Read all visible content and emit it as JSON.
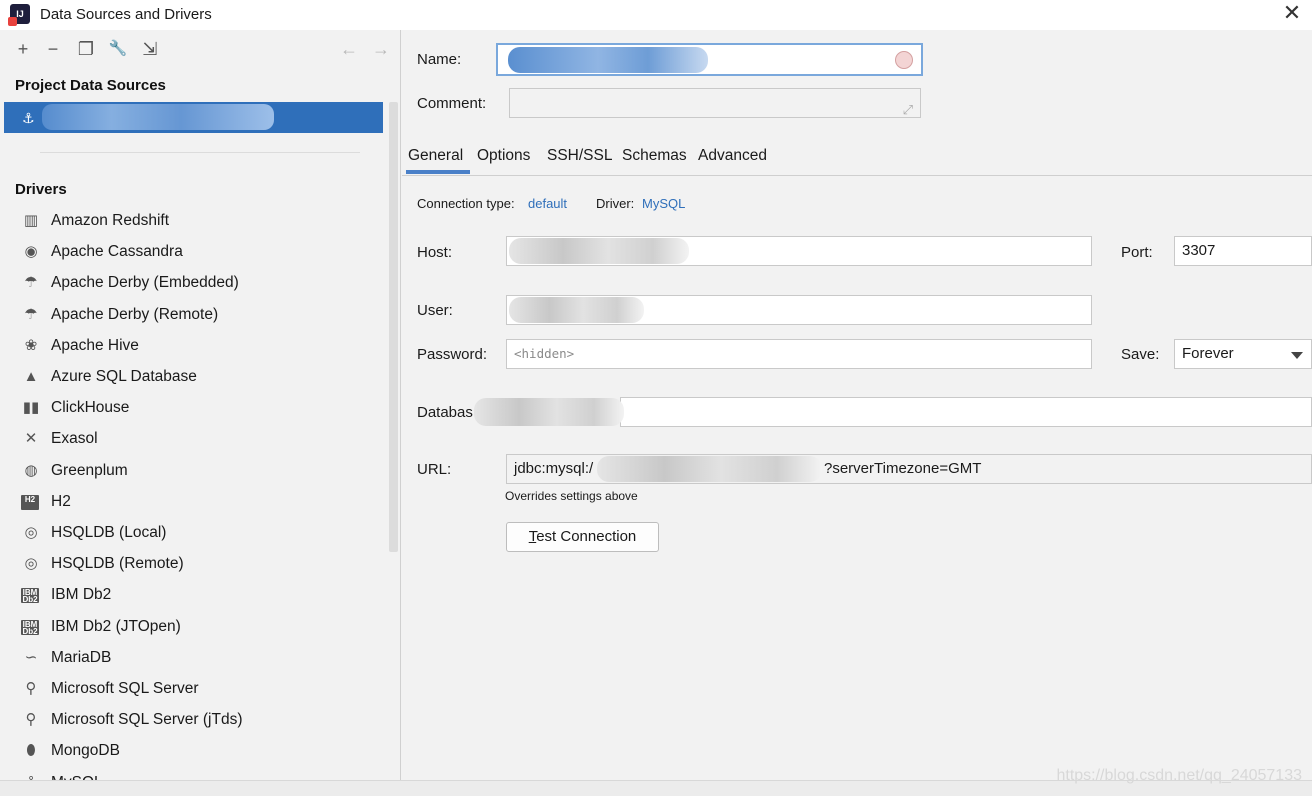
{
  "window": {
    "title": "Data Sources and Drivers",
    "close_glyph": "✕"
  },
  "toolbar": {
    "add": "+",
    "remove": "−",
    "duplicate": "❐",
    "settings": "🔧",
    "import": "⇲",
    "back": "←",
    "forward": "→"
  },
  "sidebar": {
    "project_heading": "Project Data Sources",
    "drivers_heading": "Drivers",
    "drivers": [
      {
        "label": "Amazon Redshift",
        "icon": "amazon-redshift-icon",
        "glyph": "▥"
      },
      {
        "label": "Apache Cassandra",
        "icon": "cassandra-icon",
        "glyph": "◉"
      },
      {
        "label": "Apache Derby (Embedded)",
        "icon": "derby-icon",
        "glyph": "☂"
      },
      {
        "label": "Apache Derby (Remote)",
        "icon": "derby-icon",
        "glyph": "☂"
      },
      {
        "label": "Apache Hive",
        "icon": "hive-icon",
        "glyph": "❀"
      },
      {
        "label": "Azure SQL Database",
        "icon": "azure-icon",
        "glyph": "▲"
      },
      {
        "label": "ClickHouse",
        "icon": "clickhouse-icon",
        "glyph": "▮▮"
      },
      {
        "label": "Exasol",
        "icon": "exasol-icon",
        "glyph": "✕"
      },
      {
        "label": "Greenplum",
        "icon": "greenplum-icon",
        "glyph": "◍"
      },
      {
        "label": "H2",
        "icon": "h2-icon",
        "glyph": "H2"
      },
      {
        "label": "HSQLDB (Local)",
        "icon": "hsqldb-icon",
        "glyph": "◎"
      },
      {
        "label": "HSQLDB (Remote)",
        "icon": "hsqldb-icon",
        "glyph": "◎"
      },
      {
        "label": "IBM Db2",
        "icon": "ibm-db2-icon",
        "glyph": "IBM Db2"
      },
      {
        "label": "IBM Db2 (JTOpen)",
        "icon": "ibm-db2-icon",
        "glyph": "IBM Db2"
      },
      {
        "label": "MariaDB",
        "icon": "mariadb-icon",
        "glyph": "∽"
      },
      {
        "label": "Microsoft SQL Server",
        "icon": "mssql-icon",
        "glyph": "⚲"
      },
      {
        "label": "Microsoft SQL Server (jTds)",
        "icon": "mssql-icon",
        "glyph": "⚲"
      },
      {
        "label": "MongoDB",
        "icon": "mongodb-icon",
        "glyph": "⬮"
      },
      {
        "label": "MySQL",
        "icon": "mysql-icon",
        "glyph": "⚓"
      }
    ]
  },
  "form": {
    "name_label": "Name:",
    "comment_label": "Comment:",
    "tabs": [
      "General",
      "Options",
      "SSH/SSL",
      "Schemas",
      "Advanced"
    ],
    "connection_type_label": "Connection type:",
    "connection_type_value": "default",
    "driver_label": "Driver:",
    "driver_value": "MySQL",
    "host_label": "Host:",
    "port_label": "Port:",
    "port_value": "3307",
    "user_label": "User:",
    "password_label": "Password:",
    "password_placeholder": "<hidden>",
    "save_label": "Save:",
    "save_value": "Forever",
    "database_label": "Databas",
    "url_label": "URL:",
    "url_prefix": "jdbc:mysql:/",
    "url_suffix": "?serverTimezone=GMT",
    "url_hint": "Overrides settings above",
    "test_button_mnemonic": "T",
    "test_button_rest": "est Connection"
  },
  "watermark": "https://blog.csdn.net/qq_24057133"
}
